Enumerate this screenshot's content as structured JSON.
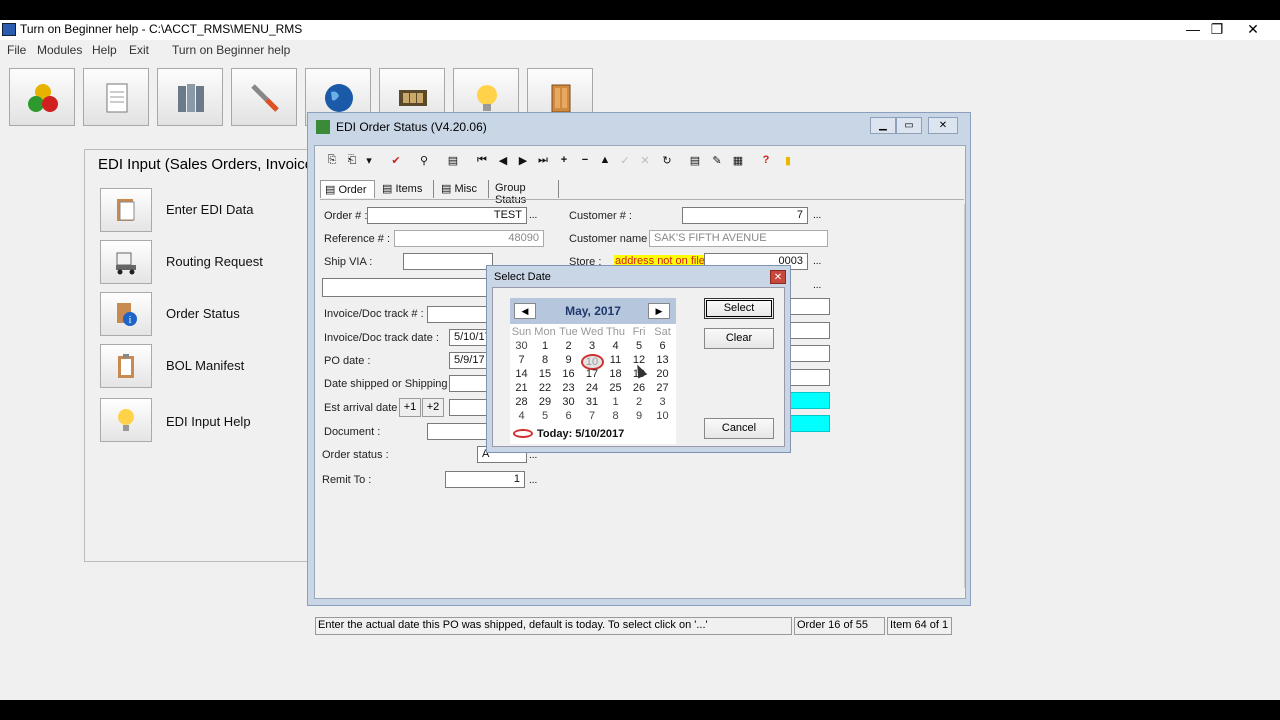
{
  "main_window": {
    "title": "Turn on Beginner help - C:\\ACCT_RMS\\MENU_RMS",
    "menu": [
      "File",
      "Modules",
      "Help",
      "Exit",
      "Turn on Beginner help"
    ],
    "controls": {
      "minimize": "—",
      "restore": "❐",
      "close": "✕"
    }
  },
  "left_panel": {
    "title": "EDI Input (Sales Orders, Invoice,",
    "items": [
      {
        "label": "Enter EDI Data",
        "icon": "document-folder-icon"
      },
      {
        "label": "Routing Request",
        "icon": "truck-icon"
      },
      {
        "label": "Order Status",
        "icon": "info-icon"
      },
      {
        "label": "BOL Manifest",
        "icon": "clipboard-icon"
      },
      {
        "label": "EDI Input Help",
        "icon": "lightbulb-icon"
      }
    ]
  },
  "edi_window": {
    "title": "EDI Order Status (V4.20.06)",
    "tabs": [
      "Order",
      "Items",
      "Misc",
      "Group Status"
    ],
    "toolbar": [
      "⎘",
      "⎗",
      "▾",
      "✔",
      "⚲",
      "▤",
      "⏮",
      "◀",
      "▶",
      "⏭",
      "+",
      "−",
      "▲",
      "✓",
      "✕",
      "↻",
      "▤",
      "✎",
      "▦",
      "?",
      "▮"
    ],
    "fields": {
      "order_no": {
        "label": "Order # :",
        "value": "TEST"
      },
      "reference_no": {
        "label": "Reference # :",
        "value": "48090"
      },
      "ship_via": {
        "label": "Ship VIA :",
        "value": ""
      },
      "invoice_track_no": {
        "label": "Invoice/Doc track # :",
        "value": ""
      },
      "invoice_track_date": {
        "label": "Invoice/Doc track date :",
        "value": "5/10/17"
      },
      "po_date": {
        "label": "PO date :",
        "value": "5/9/17"
      },
      "date_shipped": {
        "label": "Date shipped or Shipping :",
        "value": ""
      },
      "est_arrival": {
        "label": "Est arrival date :",
        "value": "",
        "plus1": "+1",
        "plus2": "+2"
      },
      "document": {
        "label": "Document :",
        "value": ""
      },
      "order_status": {
        "label": "Order status :",
        "value": "A"
      },
      "remit_to": {
        "label": "Remit To :",
        "value": "1"
      },
      "customer_no": {
        "label": "Customer # :",
        "value": "7"
      },
      "customer_name": {
        "label": "Customer name :",
        "value": "SAK'S FIFTH AVENUE"
      },
      "store": {
        "label": "Store :",
        "note": "address not on file",
        "value": "0003"
      }
    },
    "dots": "...",
    "status_bar": {
      "message": "Enter the actual date this PO was shipped, default is today. To select click on '...'",
      "order": "Order 16 of 55",
      "item": "Item 64 of 1"
    }
  },
  "select_date": {
    "title": "Select Date",
    "month": "May, 2017",
    "dow": [
      "Sun",
      "Mon",
      "Tue",
      "Wed",
      "Thu",
      "Fri",
      "Sat"
    ],
    "weeks": [
      [
        "30",
        "1",
        "2",
        "3",
        "4",
        "5",
        "6"
      ],
      [
        "7",
        "8",
        "9",
        "10",
        "11",
        "12",
        "13"
      ],
      [
        "14",
        "15",
        "16",
        "17",
        "18",
        "19",
        "20"
      ],
      [
        "21",
        "22",
        "23",
        "24",
        "25",
        "26",
        "27"
      ],
      [
        "28",
        "29",
        "30",
        "31",
        "1",
        "2",
        "3"
      ],
      [
        "4",
        "5",
        "6",
        "7",
        "8",
        "9",
        "10"
      ]
    ],
    "selected_day": "10",
    "today": "Today: 5/10/2017",
    "buttons": {
      "select": "Select",
      "clear": "Clear",
      "cancel": "Cancel"
    }
  }
}
